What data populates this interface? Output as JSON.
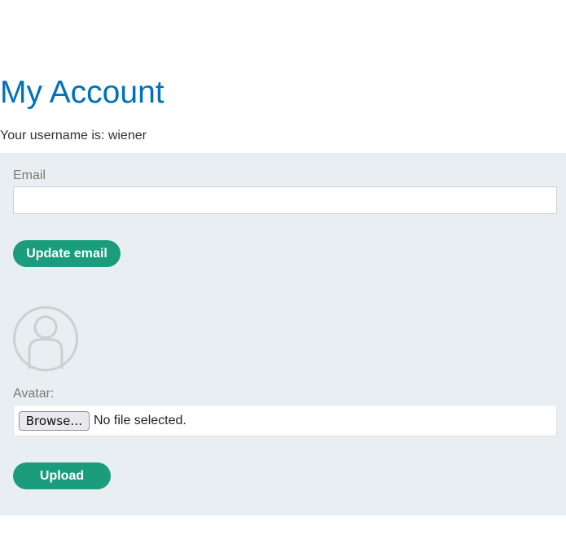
{
  "header": {
    "title": "My Account",
    "username_text": "Your username is: wiener"
  },
  "email_form": {
    "label": "Email",
    "value": "",
    "placeholder": "",
    "submit_label": "Update email"
  },
  "avatar_form": {
    "avatar_icon": "user-silhouette-icon",
    "label": "Avatar:",
    "browse_label": "Browse…",
    "file_status": "No file selected.",
    "submit_label": "Upload"
  },
  "colors": {
    "title": "#0071bc",
    "button": "#1a9c7d",
    "panel": "#e8eef2"
  }
}
